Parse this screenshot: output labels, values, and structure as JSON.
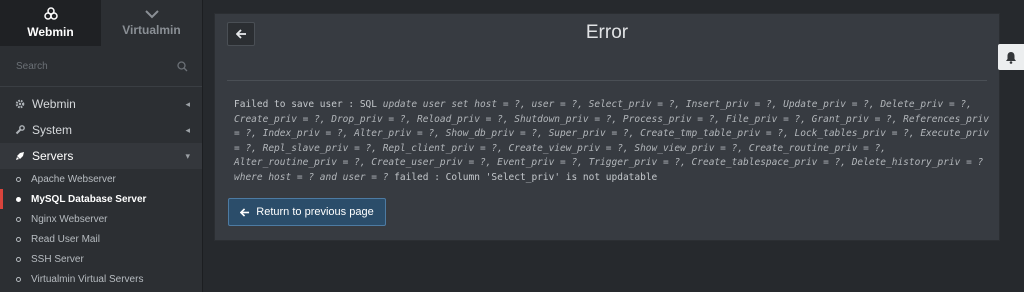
{
  "sidebar": {
    "tabs": [
      {
        "label": "Webmin",
        "icon": "webmin-logo-icon",
        "active": true
      },
      {
        "label": "Virtualmin",
        "icon": "chevron-down-icon",
        "active": false
      }
    ],
    "search": {
      "placeholder": "Search"
    },
    "categories": [
      {
        "label": "Webmin",
        "icon": "gear-icon",
        "open": false
      },
      {
        "label": "System",
        "icon": "wrench-icon",
        "open": false
      },
      {
        "label": "Servers",
        "icon": "rocket-icon",
        "open": true
      }
    ],
    "servers_items": [
      {
        "label": "Apache Webserver",
        "active": false
      },
      {
        "label": "MySQL Database Server",
        "active": true
      },
      {
        "label": "Nginx Webserver",
        "active": false
      },
      {
        "label": "Read User Mail",
        "active": false
      },
      {
        "label": "SSH Server",
        "active": false
      },
      {
        "label": "Virtualmin Virtual Servers",
        "active": false
      }
    ]
  },
  "main": {
    "title": "Error",
    "error_prefix": "Failed to save user : SQL",
    "sql": "update user set host = ?, user = ?, Select_priv = ?, Insert_priv = ?, Update_priv = ?, Delete_priv = ?, Create_priv = ?, Drop_priv = ?, Reload_priv = ?, Shutdown_priv = ?, Process_priv = ?, File_priv = ?, Grant_priv = ?, References_priv = ?, Index_priv = ?, Alter_priv = ?, Show_db_priv = ?, Super_priv = ?, Create_tmp_table_priv = ?, Lock_tables_priv = ?, Execute_priv = ?, Repl_slave_priv = ?, Repl_client_priv = ?, Create_view_priv = ?, Show_view_priv = ?, Create_routine_priv = ?, Alter_routine_priv = ?, Create_user_priv = ?, Event_priv = ?, Trigger_priv = ?, Create_tablespace_priv = ?, Delete_history_priv = ? where host = ? and user = ?",
    "error_suffix": "failed : Column 'Select_priv' is not updatable",
    "return_label": "Return to previous page"
  },
  "colors": {
    "accent_active": "#d9443c",
    "button_primary": "#2b4d6a"
  }
}
